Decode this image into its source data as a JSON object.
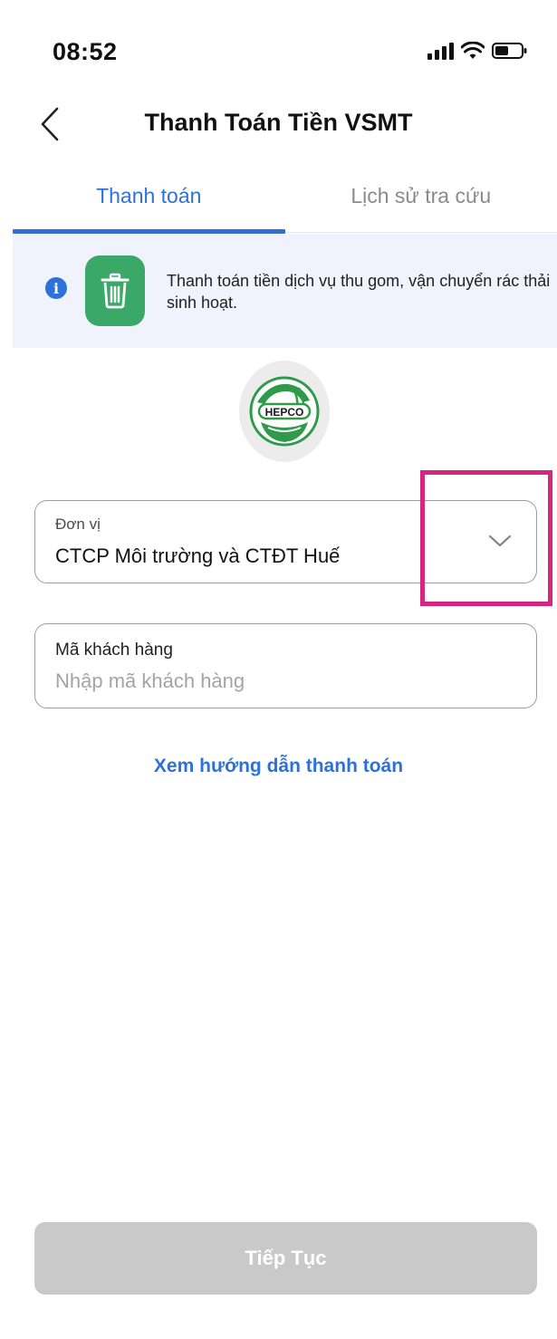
{
  "status_bar": {
    "time": "08:52",
    "icons": [
      "signal-icon",
      "wifi-icon",
      "battery-icon"
    ]
  },
  "header": {
    "title": "Thanh Toán Tiền VSMT",
    "back_icon": "chevron-left-icon"
  },
  "tabs": [
    {
      "label": "Thanh toán",
      "active": true
    },
    {
      "label": "Lịch sử tra cứu",
      "active": false
    }
  ],
  "info": {
    "text": "Thanh toán tiền dịch vụ thu gom, vận chuyển rác thải sinh hoạt.",
    "icon": "trash-icon"
  },
  "logo": {
    "text": "HEPCO"
  },
  "form": {
    "unit": {
      "label": "Đơn vị",
      "value": "CTCP Môi trường và CTĐT Huế"
    },
    "customer_code": {
      "label": "Mã khách hàng",
      "value": "",
      "placeholder": "Nhập mã khách hàng"
    }
  },
  "guide_link": "Xem hướng dẫn thanh toán",
  "continue_button": "Tiếp Tục",
  "colors": {
    "accent": "#2d72d9",
    "trash_tile": "#3aa869",
    "highlight": "#d6267f",
    "button_disabled": "#c9c9c9"
  }
}
